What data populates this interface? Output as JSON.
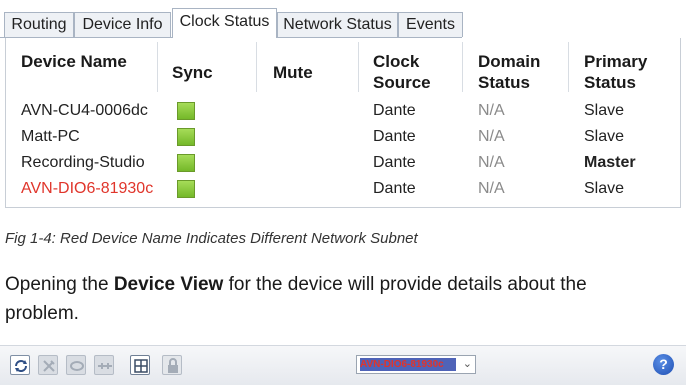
{
  "tabs": [
    "Routing",
    "Device Info",
    "Clock Status",
    "Network Status",
    "Events"
  ],
  "table": {
    "headers": {
      "device_name": "Device Name",
      "sync": "Sync",
      "mute": "Mute",
      "clock_source": "Clock Source",
      "domain_status": "Domain Status",
      "primary_status": "Primary Status"
    },
    "rows": [
      {
        "device_name": "AVN-CU4-0006dc",
        "clock_source": "Dante",
        "domain_status": "N/A",
        "primary_status": "Slave"
      },
      {
        "device_name": "Matt-PC",
        "clock_source": "Dante",
        "domain_status": "N/A",
        "primary_status": "Slave"
      },
      {
        "device_name": "Recording-Studio",
        "clock_source": "Dante",
        "domain_status": "N/A",
        "primary_status": "Master"
      },
      {
        "device_name": "AVN-DIO6-81930c",
        "clock_source": "Dante",
        "domain_status": "N/A",
        "primary_status": "Slave"
      }
    ]
  },
  "caption": "Fig 1-4: Red Device Name Indicates Different Network Subnet",
  "paragraph": {
    "before": "Opening the ",
    "bold": "Device View",
    "after": " for the device will provide details about the problem."
  },
  "toolbar": {
    "device_select_value": "AVN-DIO6-81930c",
    "help_label": "?"
  },
  "colors": {
    "sync_ok": "#8cc63f",
    "subnet_warning": "#e0352b",
    "select_highlight": "#4f63b8",
    "help_button": "#2a5fc7"
  },
  "icons": [
    "refresh-icon",
    "tools-icon",
    "network-icon",
    "connection-icon",
    "grid-icon",
    "lock-icon",
    "chevron-down-icon",
    "help-icon"
  ]
}
